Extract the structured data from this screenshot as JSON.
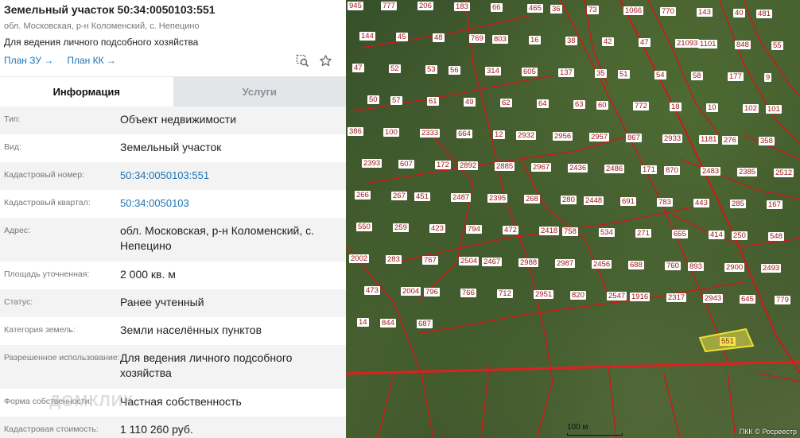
{
  "header": {
    "title": "Земельный участок 50:34:0050103:551",
    "address": "обл. Московская, р-н Коломенский, с. Непецино",
    "purpose": "Для ведения личного подсобного хозяйства",
    "plan_zu": "План ЗУ →",
    "plan_kk": "План КК →"
  },
  "tabs": [
    {
      "label": "Информация",
      "active": true
    },
    {
      "label": "Услуги",
      "active": false
    }
  ],
  "rows": [
    {
      "label": "Тип:",
      "value": "Объект недвижимости"
    },
    {
      "label": "Вид:",
      "value": "Земельный участок"
    },
    {
      "label": "Кадастровый номер:",
      "value": "50:34:0050103:551"
    },
    {
      "label": "Кадастровый квартал:",
      "value": "50:34:0050103"
    },
    {
      "label": "Адрес:",
      "value": "обл. Московская, р-н Коломенский, с. Непецино"
    },
    {
      "label": "Площадь уточненная:",
      "value": "2 000 кв. м"
    },
    {
      "label": "Статус:",
      "value": "Ранее учтенный"
    },
    {
      "label": "Категория земель:",
      "value": "Земли населённых пунктов"
    },
    {
      "label": "Разрешенное использование:",
      "value": "Для ведения личного подсобного хозяйства"
    },
    {
      "label": "Форма собственности:",
      "value": "Частная собственность"
    },
    {
      "label": "Кадастровая стоимость:",
      "value": "1 110 260 руб."
    }
  ],
  "watermark": "ДОМКЛИК",
  "map": {
    "highlight_label": "551",
    "scale_label": "100 м",
    "copyright": "ПКК © Росреестр",
    "parcel_labels": [
      "945",
      "777",
      "206",
      "183",
      "66",
      "465",
      "36",
      "73",
      "1066",
      "770",
      "143",
      "40",
      "481",
      "144",
      "45",
      "48",
      "769",
      "803",
      "16",
      "38",
      "42",
      "47",
      "21093",
      "1101",
      "848",
      "55",
      "47",
      "52",
      "53",
      "56",
      "314",
      "605",
      "137",
      "35",
      "51",
      "54",
      "58",
      "177",
      "9",
      "50",
      "57",
      "61",
      "49",
      "62",
      "64",
      "63",
      "60",
      "772",
      "18",
      "10",
      "102",
      "101",
      "386",
      "100",
      "2333",
      "664",
      "12",
      "2932",
      "2956",
      "2957",
      "867",
      "2933",
      "1181",
      "276",
      "358",
      "2393",
      "607",
      "172",
      "2892",
      "2885",
      "2967",
      "2436",
      "2486",
      "171",
      "870",
      "2483",
      "2385",
      "2512",
      "266",
      "267",
      "451",
      "2487",
      "2395",
      "268",
      "280",
      "2448",
      "691",
      "783",
      "443",
      "285",
      "167",
      "550",
      "259",
      "423",
      "794",
      "472",
      "2418",
      "758",
      "534",
      "271",
      "655",
      "414",
      "250",
      "548",
      "2002",
      "283",
      "767",
      "2504",
      "2467",
      "2988",
      "2987",
      "2456",
      "688",
      "760",
      "893",
      "2900",
      "2493",
      "473",
      "2004",
      "796",
      "766",
      "712",
      "2951",
      "820",
      "2547",
      "1916",
      "2317",
      "2943",
      "645",
      "779",
      "14",
      "844",
      "687"
    ]
  }
}
